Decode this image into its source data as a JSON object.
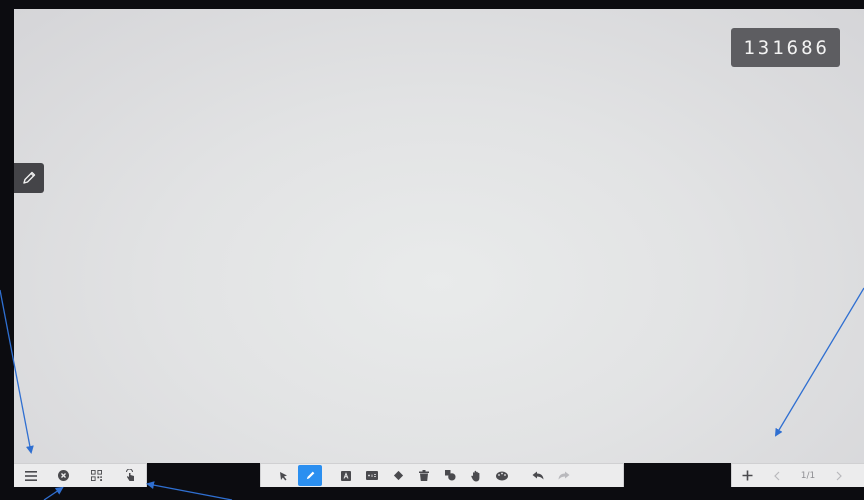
{
  "room_code": "131686",
  "side_tool": {
    "icon": "pencil-icon"
  },
  "left_toolbar": {
    "items": [
      {
        "name": "menu",
        "icon": "hamburger-menu-icon"
      },
      {
        "name": "close",
        "icon": "close-circle-icon"
      },
      {
        "name": "qr-code",
        "icon": "qr-code-icon"
      },
      {
        "name": "touch",
        "icon": "touch-hand-icon"
      }
    ]
  },
  "center_toolbar": {
    "active_tool": "pen",
    "items": [
      {
        "name": "select",
        "icon": "cursor-arrow-icon"
      },
      {
        "name": "pen",
        "icon": "pen-icon"
      },
      {
        "name": "text",
        "icon": "text-box-icon"
      },
      {
        "name": "math-formula",
        "icon": "formula-icon"
      },
      {
        "name": "eraser",
        "icon": "eraser-icon"
      },
      {
        "name": "delete",
        "icon": "trash-icon"
      },
      {
        "name": "shapes",
        "icon": "shapes-icon"
      },
      {
        "name": "pan",
        "icon": "hand-icon"
      },
      {
        "name": "color-palette",
        "icon": "palette-icon"
      },
      {
        "name": "undo",
        "icon": "undo-icon"
      },
      {
        "name": "redo",
        "icon": "redo-icon"
      }
    ]
  },
  "right_toolbar": {
    "add_page_icon": "plus-icon",
    "prev_icon": "chevron-left-icon",
    "page_indicator": "1/1",
    "next_icon": "chevron-right-icon"
  },
  "colors": {
    "canvas": "#e6e7e8",
    "toolbar": "#ececed",
    "active_tool": "#2b8ff0",
    "room_code_bg": "#5d5d61",
    "annotation_arrow": "#2f6fd1"
  }
}
